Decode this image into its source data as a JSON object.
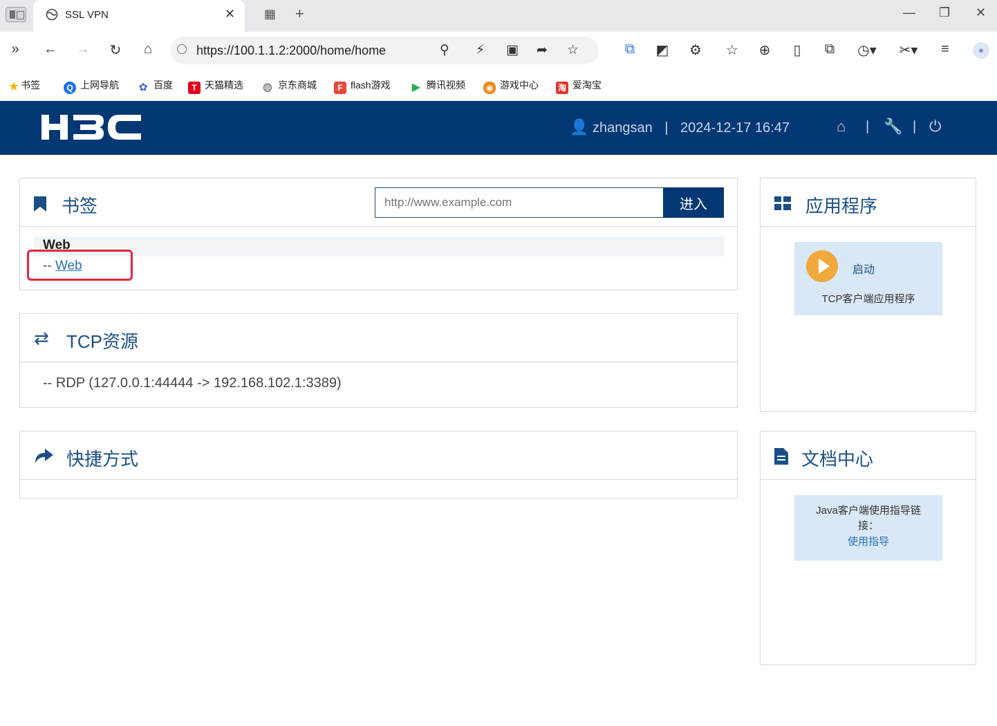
{
  "browser": {
    "tab_title": "SSL VPN",
    "url": "https://100.1.1.2:2000/home/home",
    "bookmarks": [
      {
        "label": "书签",
        "icon": "star-icon",
        "color": "#f5b400"
      },
      {
        "label": "上网导航",
        "icon": "q-icon",
        "color": "#1e6fe8"
      },
      {
        "label": "百度",
        "icon": "baidu-paw-icon",
        "color": "#2f5cd6"
      },
      {
        "label": "天猫精选",
        "icon": "tmall-icon",
        "color": "#e3001b"
      },
      {
        "label": "京东商城",
        "icon": "globe-icon",
        "color": "#666666"
      },
      {
        "label": "flash游戏",
        "icon": "flash-game-icon",
        "color": "#e8473a"
      },
      {
        "label": "腾讯视频",
        "icon": "tencent-video-icon",
        "color": "#22b04a"
      },
      {
        "label": "游戏中心",
        "icon": "gamepad-icon",
        "color": "#f08a1c"
      },
      {
        "label": "爱淘宝",
        "icon": "taobao-icon",
        "color": "#e4312c"
      }
    ]
  },
  "header": {
    "logo_text": "H3C",
    "username": "zhangsan",
    "separator": "|",
    "datetime": "2024-12-17 16:47"
  },
  "bookmarks_panel": {
    "title": "书签",
    "url_placeholder": "http://www.example.com",
    "go_label": "进入",
    "group_name": "Web",
    "link_prefix": "-- ",
    "link_label": "Web"
  },
  "tcp_panel": {
    "title": "TCP资源",
    "item": "-- RDP (127.0.0.1:44444 -> 192.168.102.1:3389)"
  },
  "shortcut_panel": {
    "title": "快捷方式"
  },
  "apps_panel": {
    "title": "应用程序",
    "launch_label": "启动",
    "app_name": "TCP客户端应用程序"
  },
  "docs_panel": {
    "title": "文档中心",
    "guide_text": "Java客户端使用指导链接：",
    "guide_link": "使用指导"
  },
  "colors": {
    "header_bg": "#033874",
    "title_blue": "#1b4f85",
    "card_bg": "#d9e8f7",
    "highlight_red": "#e0283c",
    "launch_orange": "#f2a93b"
  }
}
